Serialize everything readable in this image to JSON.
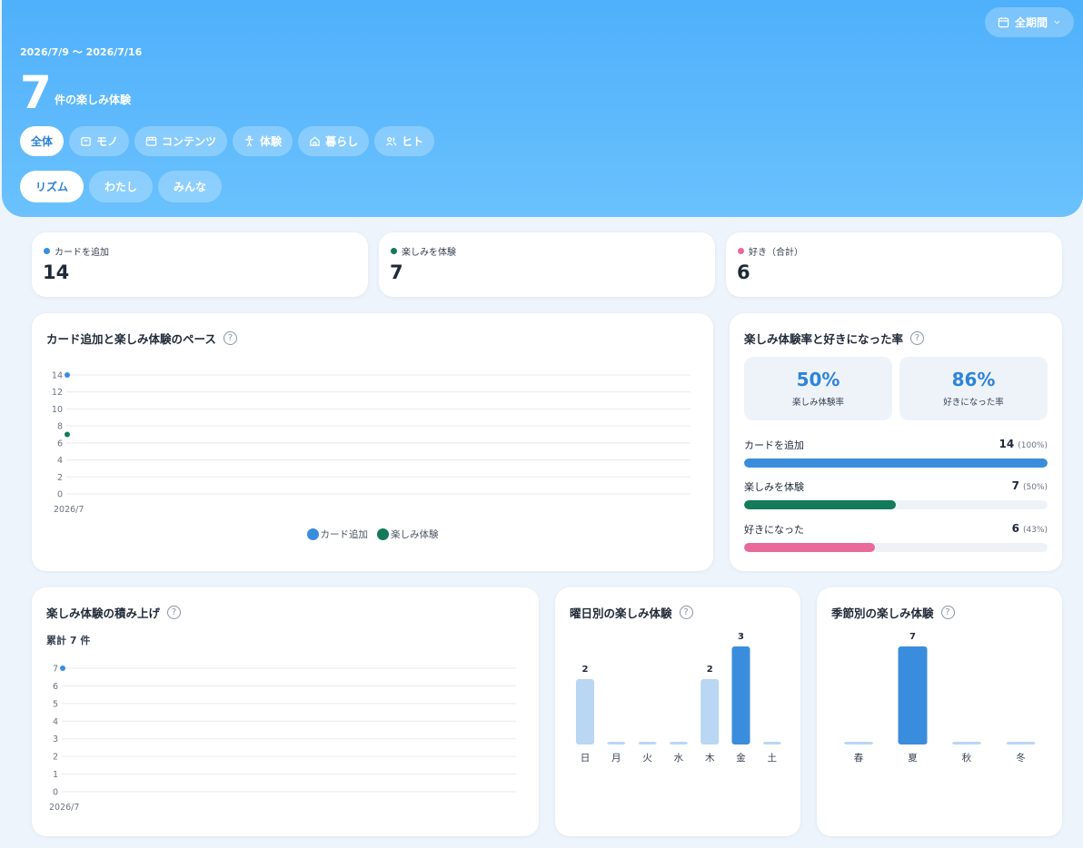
{
  "header": {
    "period_button": "全期間",
    "date_range": "2026/7/9 〜 2026/7/16",
    "count": "7",
    "count_label": "件の楽しみ体験",
    "categories": [
      {
        "label": "全体",
        "icon": "none",
        "active": true
      },
      {
        "label": "モノ",
        "icon": "bag-icon",
        "active": false
      },
      {
        "label": "コンテンツ",
        "icon": "media-icon",
        "active": false
      },
      {
        "label": "体験",
        "icon": "person-icon",
        "active": false
      },
      {
        "label": "暮らし",
        "icon": "home-icon",
        "active": false
      },
      {
        "label": "ヒト",
        "icon": "people-icon",
        "active": false
      }
    ],
    "views": [
      {
        "label": "リズム",
        "active": true
      },
      {
        "label": "わたし",
        "active": false
      },
      {
        "label": "みんな",
        "active": false
      }
    ]
  },
  "stats": [
    {
      "label": "カードを追加",
      "value": "14",
      "color": "#3a8ddd"
    },
    {
      "label": "楽しみを体験",
      "value": "7",
      "color": "#137a5a"
    },
    {
      "label": "好き（合計）",
      "value": "6",
      "color": "#e8699a"
    }
  ],
  "pace": {
    "title": "カード追加と楽しみ体験のペース",
    "legend": [
      {
        "label": "カード追加",
        "color": "#3a8ddd"
      },
      {
        "label": "楽しみ体験",
        "color": "#137a5a"
      }
    ]
  },
  "rates": {
    "title": "楽しみ体験率と好きになった率",
    "boxes": [
      {
        "value": "50%",
        "caption": "楽しみ体験率"
      },
      {
        "value": "86%",
        "caption": "好きになった率"
      }
    ],
    "bars": [
      {
        "label": "カードを追加",
        "value": "14",
        "pct": "(100%)",
        "fraction": 1.0,
        "color": "#3a8ddd"
      },
      {
        "label": "楽しみを体験",
        "value": "7",
        "pct": "(50%)",
        "fraction": 0.5,
        "color": "#137a5a"
      },
      {
        "label": "好きになった",
        "value": "6",
        "pct": "(43%)",
        "fraction": 0.43,
        "color": "#e8699a"
      }
    ]
  },
  "cumulative": {
    "title": "楽しみ体験の積み上げ",
    "total": "累計 7 件"
  },
  "weekday": {
    "title": "曜日別の楽しみ体験"
  },
  "season": {
    "title": "季節別の楽しみ体験"
  },
  "chart_data": [
    {
      "type": "scatter",
      "x": [
        "2026/7"
      ],
      "series": [
        {
          "name": "カード追加",
          "values": [
            14
          ]
        },
        {
          "name": "楽しみ体験",
          "values": [
            7
          ]
        }
      ],
      "yticks": [
        "0",
        "2",
        "4",
        "6",
        "8",
        "10",
        "12",
        "14"
      ],
      "ylim": [
        0,
        14
      ],
      "grid": true,
      "legend": "bottom"
    },
    {
      "type": "scatter",
      "x": [
        "2026/7"
      ],
      "values": [
        7
      ],
      "yticks": [
        "0",
        "1",
        "2",
        "3",
        "4",
        "5",
        "6",
        "7"
      ],
      "ylim": [
        0,
        7
      ],
      "grid": true
    },
    {
      "type": "bar",
      "categories": [
        "日",
        "月",
        "火",
        "水",
        "木",
        "金",
        "土"
      ],
      "values": [
        2,
        0,
        0,
        0,
        2,
        3,
        0
      ],
      "highlight": 5
    },
    {
      "type": "bar",
      "categories": [
        "春",
        "夏",
        "秋",
        "冬"
      ],
      "values": [
        0,
        7,
        0,
        0
      ],
      "highlight": 1
    }
  ]
}
